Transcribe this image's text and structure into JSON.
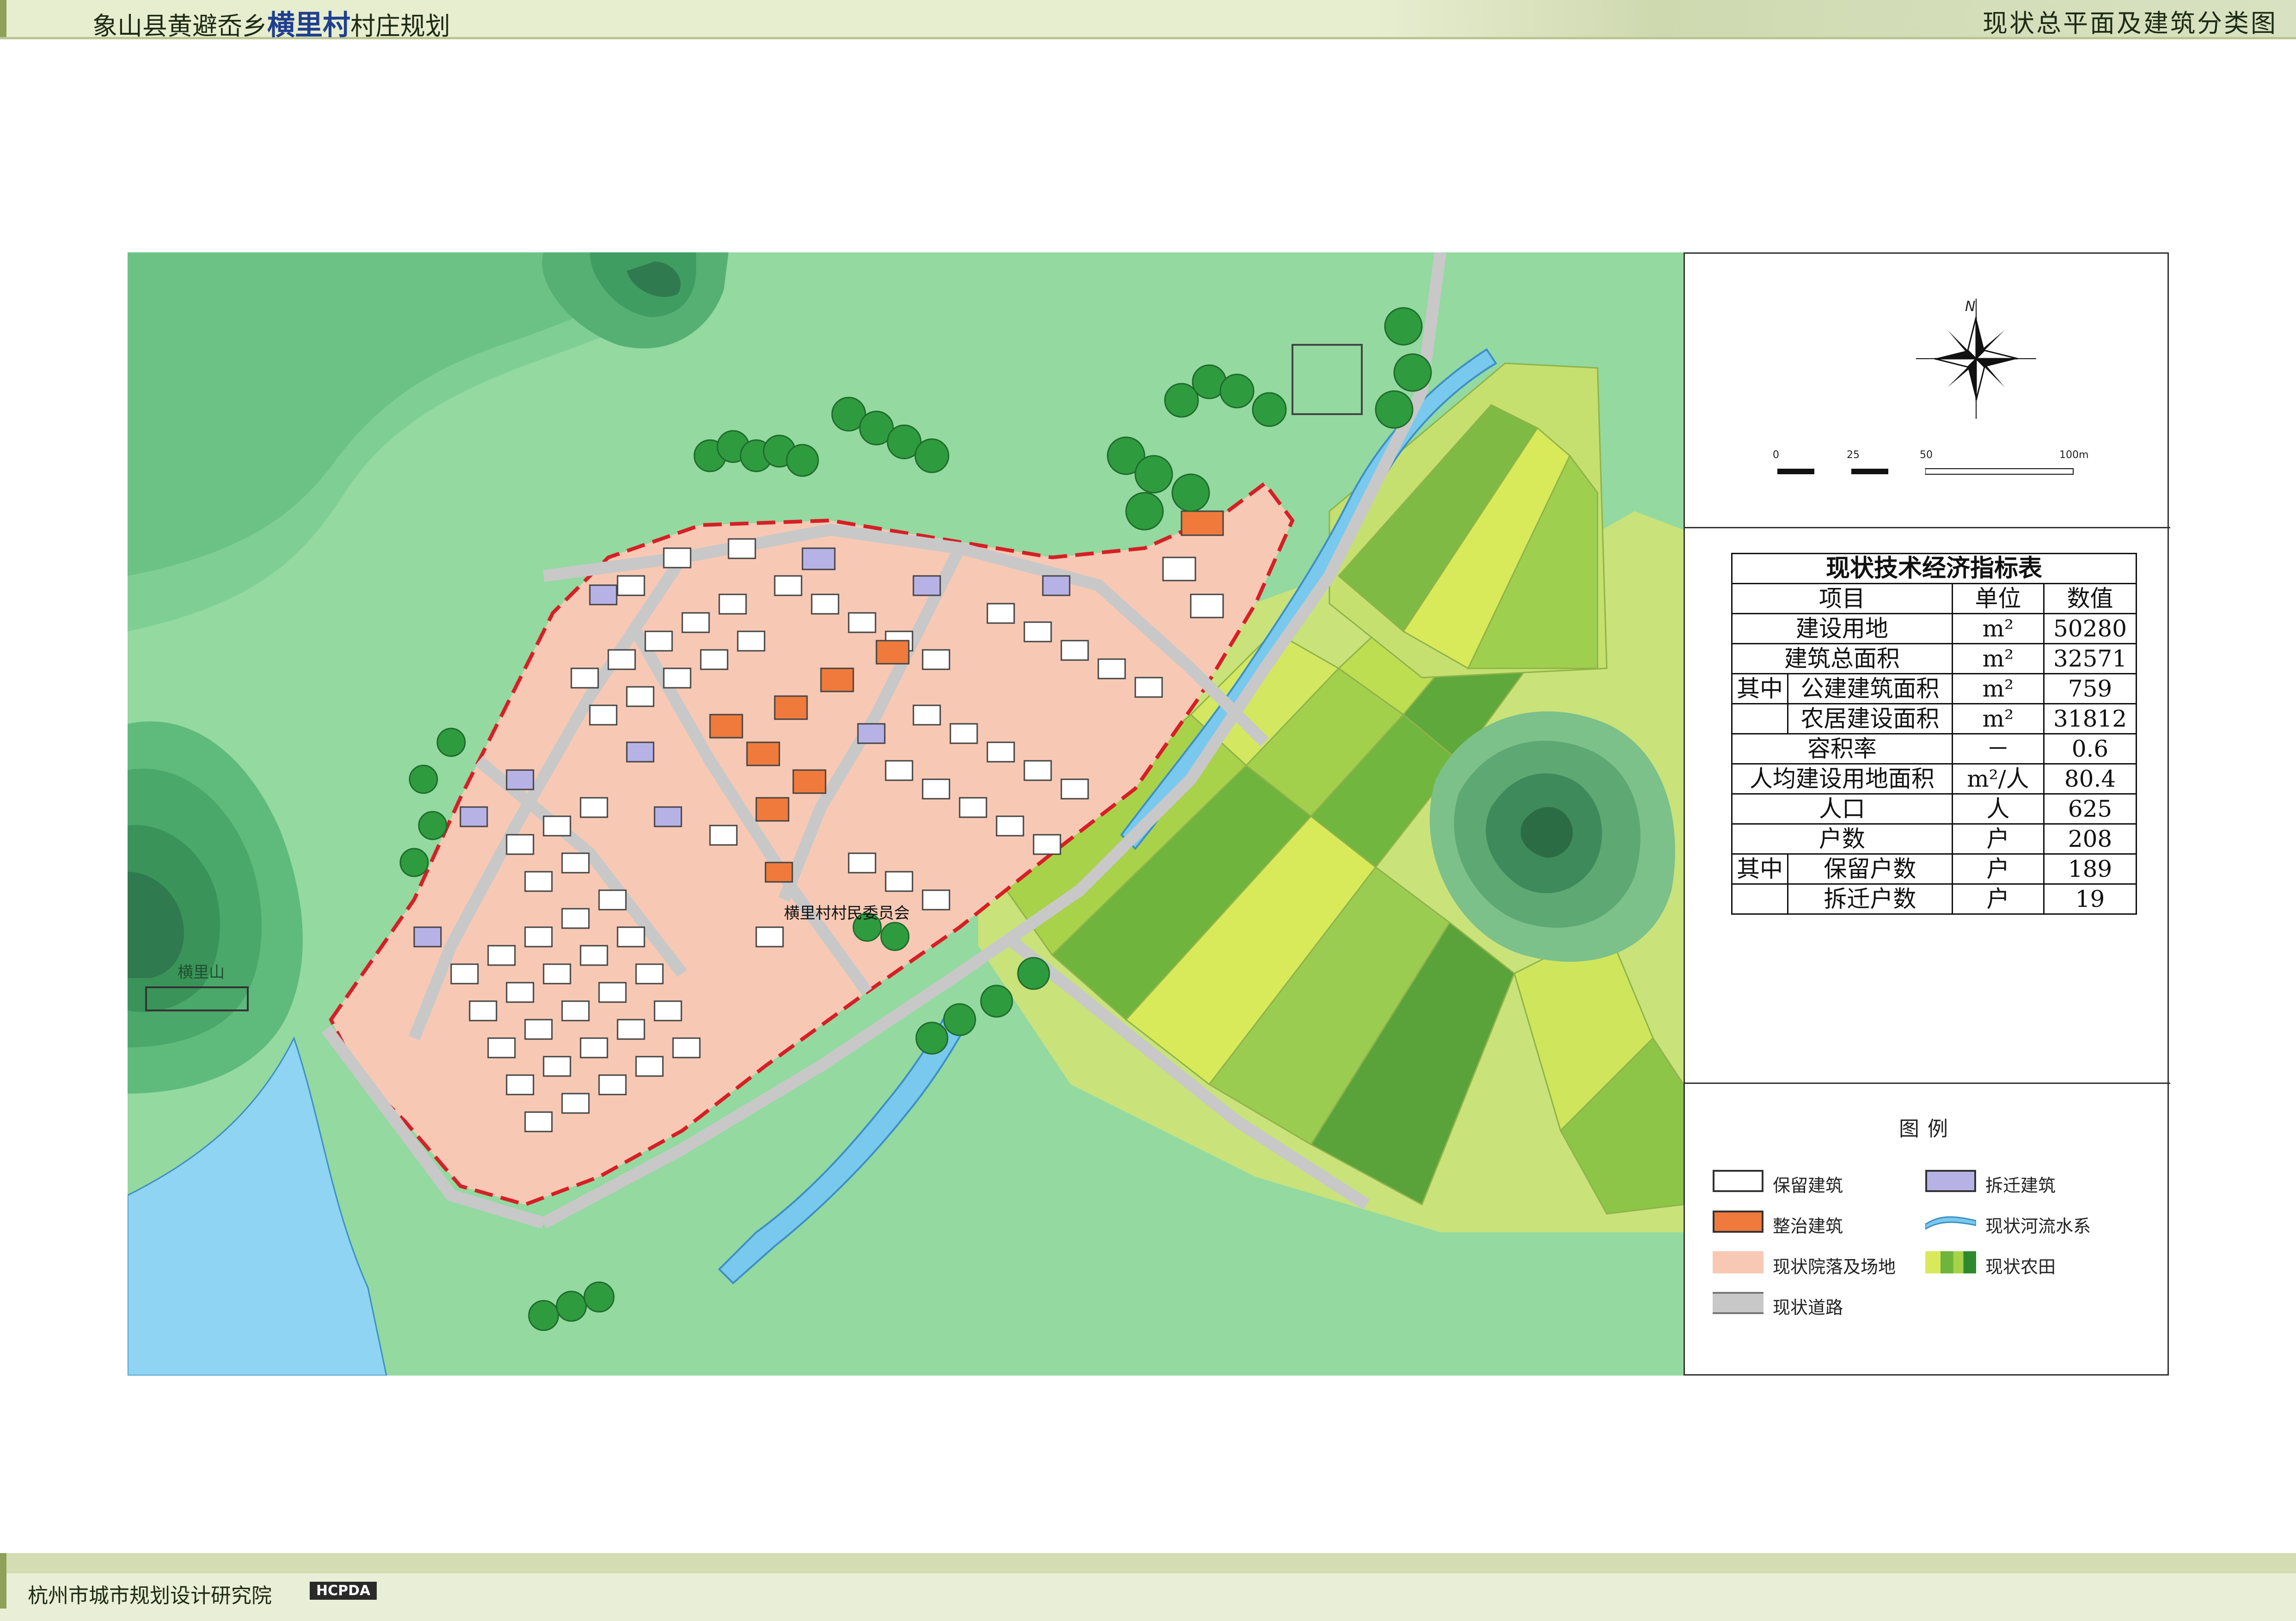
{
  "header": {
    "title_prefix": "象山县黄避岙乡",
    "title_highlight": "横里村",
    "title_suffix": "村庄规划",
    "drawing_name": "现状总平面及建筑分类图"
  },
  "footer": {
    "organization": "杭州市城市规划设计研究院",
    "badge": "HCPDA"
  },
  "map": {
    "labels": {
      "village_committee": "横里村村民委员会",
      "mountain": "横里山"
    }
  },
  "compass": {
    "north": "N"
  },
  "scale_bar": {
    "ticks": [
      "0",
      "25",
      "50",
      "100m"
    ]
  },
  "index_table": {
    "title": "现状技术经济指标表",
    "headers": [
      "项目",
      "单位",
      "数值"
    ],
    "group_label": "其中",
    "rows": [
      {
        "item": "建设用地",
        "unit": "m²",
        "value": "50280"
      },
      {
        "item": "建筑总面积",
        "unit": "m²",
        "value": "32571"
      },
      {
        "item": "公建建筑面积",
        "unit": "m²",
        "value": "759",
        "sub": true
      },
      {
        "item": "农居建设面积",
        "unit": "m²",
        "value": "31812",
        "sub": true
      },
      {
        "item": "容积率",
        "unit": "－",
        "value": "0.6"
      },
      {
        "item": "人均建设用地面积",
        "unit": "m²/人",
        "value": "80.4"
      },
      {
        "item": "人口",
        "unit": "人",
        "value": "625"
      },
      {
        "item": "户数",
        "unit": "户",
        "value": "208"
      },
      {
        "item": "保留户数",
        "unit": "户",
        "value": "189",
        "sub": true
      },
      {
        "item": "拆迁户数",
        "unit": "户",
        "value": "19",
        "sub": true
      }
    ]
  },
  "legend": {
    "title": "图例",
    "items": [
      {
        "label": "保留建筑",
        "swatch": "retained-building-icon",
        "color": "#ffffff"
      },
      {
        "label": "拆迁建筑",
        "swatch": "demolished-building-icon",
        "color": "#b7b2e6"
      },
      {
        "label": "整治建筑",
        "swatch": "renovated-building-icon",
        "color": "#f07a3c"
      },
      {
        "label": "现状河流水系",
        "swatch": "river-icon",
        "color": "#79c9ee"
      },
      {
        "label": "现状院落及场地",
        "swatch": "courtyard-icon",
        "color": "#f7c9b4"
      },
      {
        "label": "现状农田",
        "swatch": "farmland-icon",
        "color": "#9dcc3d"
      },
      {
        "label": "现状道路",
        "swatch": "road-icon",
        "color": "#c8c8c8"
      }
    ]
  },
  "colors": {
    "background_green": "#93d9a0",
    "hill_dark": "#2f7a4e",
    "courtyard": "#f7c9b4",
    "road": "#c8c8c8",
    "water": "#79c9ee",
    "boundary": "#d61f26"
  }
}
